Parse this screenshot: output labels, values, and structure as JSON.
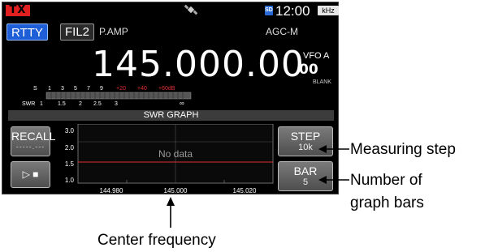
{
  "status": {
    "tx_label": "TX",
    "gps_icon": "satellite-icon",
    "sd_label": "SD",
    "clock": "12:00",
    "unit_badge": "kHz"
  },
  "mode_bar": {
    "mode": "RTTY",
    "filter": "FIL2",
    "preamp": "P.AMP",
    "agc": "AGC-M"
  },
  "frequency": "145.000.00",
  "vfo": {
    "label": "VFO A",
    "value": "00",
    "blank": "BLANK"
  },
  "meter": {
    "s_label": "S",
    "s_scale": [
      "1",
      "3",
      "5",
      "7",
      "9"
    ],
    "s_over": [
      "+20",
      "+40",
      "+60dB"
    ],
    "swr_label": "SWR",
    "swr_scale": [
      "1",
      "1.5",
      "2",
      "2.5",
      "3",
      "∞"
    ]
  },
  "swr_graph": {
    "title": "SWR GRAPH",
    "recall_label": "RECALL",
    "recall_value": "-----.---",
    "play_label": "▷ ■",
    "step_label": "STEP",
    "step_value": "10k",
    "bar_label": "BAR",
    "bar_value": "5",
    "no_data": "No data",
    "y_ticks": [
      "3.0",
      "2.0",
      "1.5",
      "1.0"
    ],
    "x_ticks": [
      "144.980",
      "145.000",
      "145.020"
    ],
    "accent_color": "#e03030"
  },
  "callouts": {
    "step": "Measuring step",
    "bar_line1": "Number of",
    "bar_line2": "graph bars",
    "center": "Center frequency"
  }
}
